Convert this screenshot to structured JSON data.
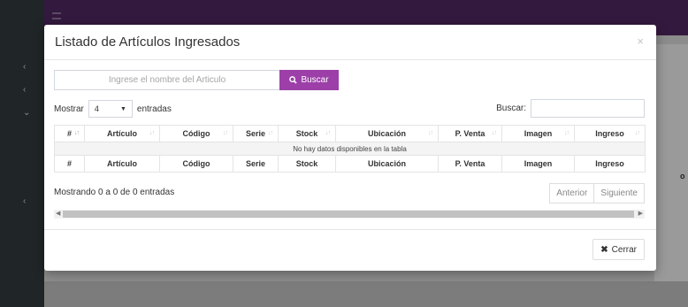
{
  "modal": {
    "title": "Listado de Artículos Ingresados",
    "close_glyph": "×"
  },
  "search": {
    "placeholder": "Ingrese el nombre del Articulo",
    "button_label": "Buscar"
  },
  "length": {
    "prefix": "Mostrar",
    "selected": "4",
    "suffix": "entradas"
  },
  "filter": {
    "label": "Buscar:"
  },
  "table": {
    "columns": [
      "#",
      "Artículo",
      "Código",
      "Serie",
      "Stock",
      "Ubicación",
      "P. Venta",
      "Imagen",
      "Ingreso"
    ],
    "empty_message": "No hay datos disponibles en la tabla",
    "footer": [
      "#",
      "Artículo",
      "Código",
      "Serie",
      "Stock",
      "Ubicación",
      "P. Venta",
      "Imagen",
      "Ingreso"
    ]
  },
  "info": "Mostrando 0 a 0 de 0 entradas",
  "pager": {
    "prev": "Anterior",
    "next": "Siguiente"
  },
  "footer": {
    "close_label": "Cerrar"
  },
  "background": {
    "panel_fragment": "o"
  },
  "colors": {
    "accent": "#9c3fa8",
    "topbar": "#34193e",
    "sidebar": "#202527"
  }
}
